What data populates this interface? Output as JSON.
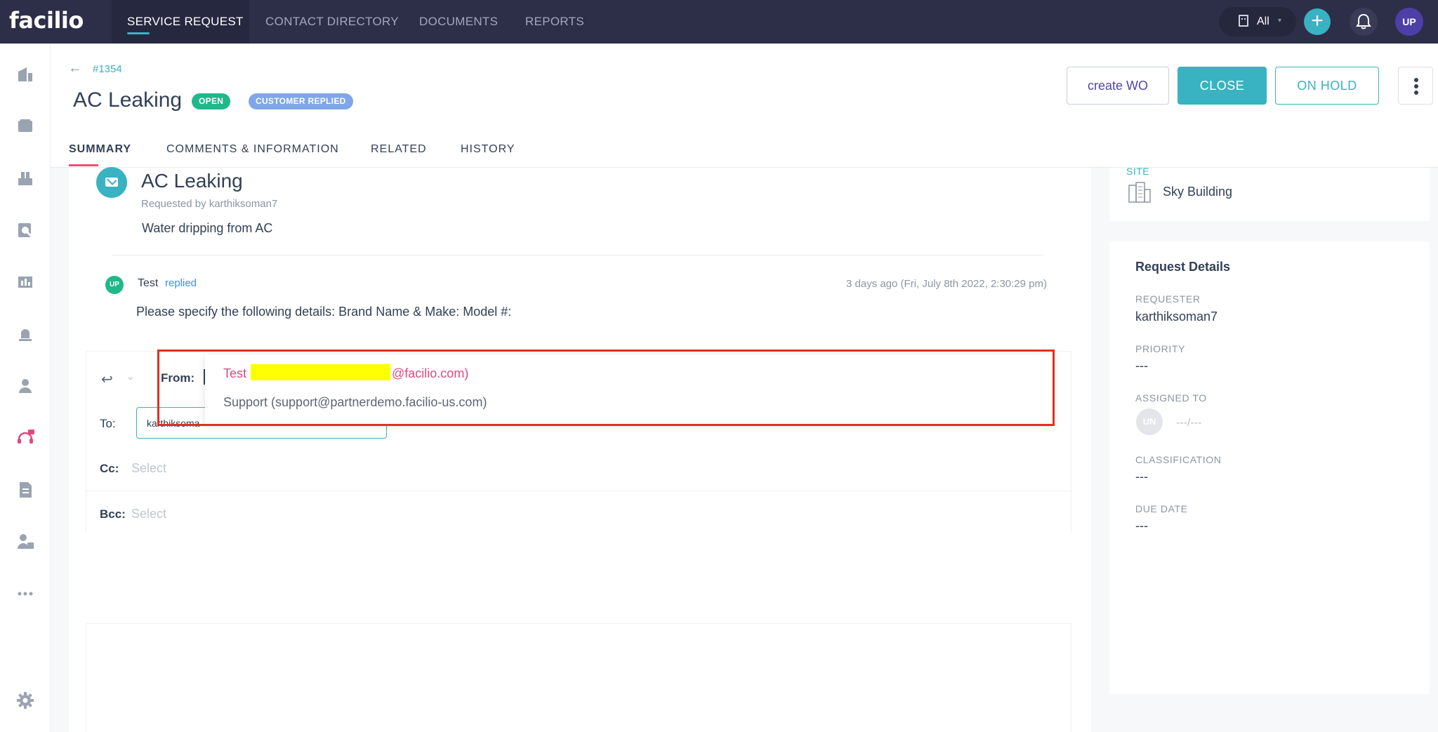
{
  "app": {
    "logo": "facilio"
  },
  "topnav": {
    "items": [
      "SERVICE REQUEST",
      "CONTACT DIRECTORY",
      "DOCUMENTS",
      "REPORTS"
    ],
    "site_filter": "All",
    "avatar": "UP"
  },
  "header": {
    "id": "#1354",
    "title": "AC Leaking",
    "badges": [
      "OPEN",
      "CUSTOMER REPLIED"
    ],
    "buttons": {
      "create_wo": "create WO",
      "close": "CLOSE",
      "on_hold": "ON HOLD"
    }
  },
  "tabs": [
    "SUMMARY",
    "COMMENTS & INFORMATION",
    "RELATED",
    "HISTORY"
  ],
  "request": {
    "subject": "AC Leaking",
    "requested_by": "Requested by karthiksoman7",
    "description": "Water dripping from AC"
  },
  "reply": {
    "avatar": "UP",
    "name": "Test",
    "verb": "replied",
    "time": "3 days ago (Fri, July 8th 2022, 2:30:29 pm)",
    "body": "Please specify the following details: Brand Name & Make: Model #:"
  },
  "composer": {
    "from_label": "From:",
    "to_label": "To:",
    "to_value": "karthiksoma",
    "cc_label": "Cc:",
    "cc_placeholder": "Select",
    "bcc_label": "Bcc:",
    "bcc_placeholder": "Select"
  },
  "from_dropdown": {
    "option1_prefix": "Test",
    "option1_suffix": "@facilio.com)",
    "option2": "Support (support@partnerdemo.facilio-us.com)"
  },
  "site_panel": {
    "label": "SITE",
    "name": "Sky Building"
  },
  "request_details": {
    "title": "Request Details",
    "requester_label": "REQUESTER",
    "requester": "karthiksoman7",
    "priority_label": "PRIORITY",
    "priority": "---",
    "assigned_label": "ASSIGNED TO",
    "assigned_avatar": "UN",
    "assigned": "---/---",
    "classification_label": "CLASSIFICATION",
    "classification": "---",
    "due_label": "DUE DATE",
    "due": "---"
  },
  "colors": {
    "accent": "#39b2c2",
    "topbar": "#2d2f48",
    "open": "#1fb88a",
    "customer_replied": "#7fa6e8",
    "highlight": "#e0311f"
  }
}
